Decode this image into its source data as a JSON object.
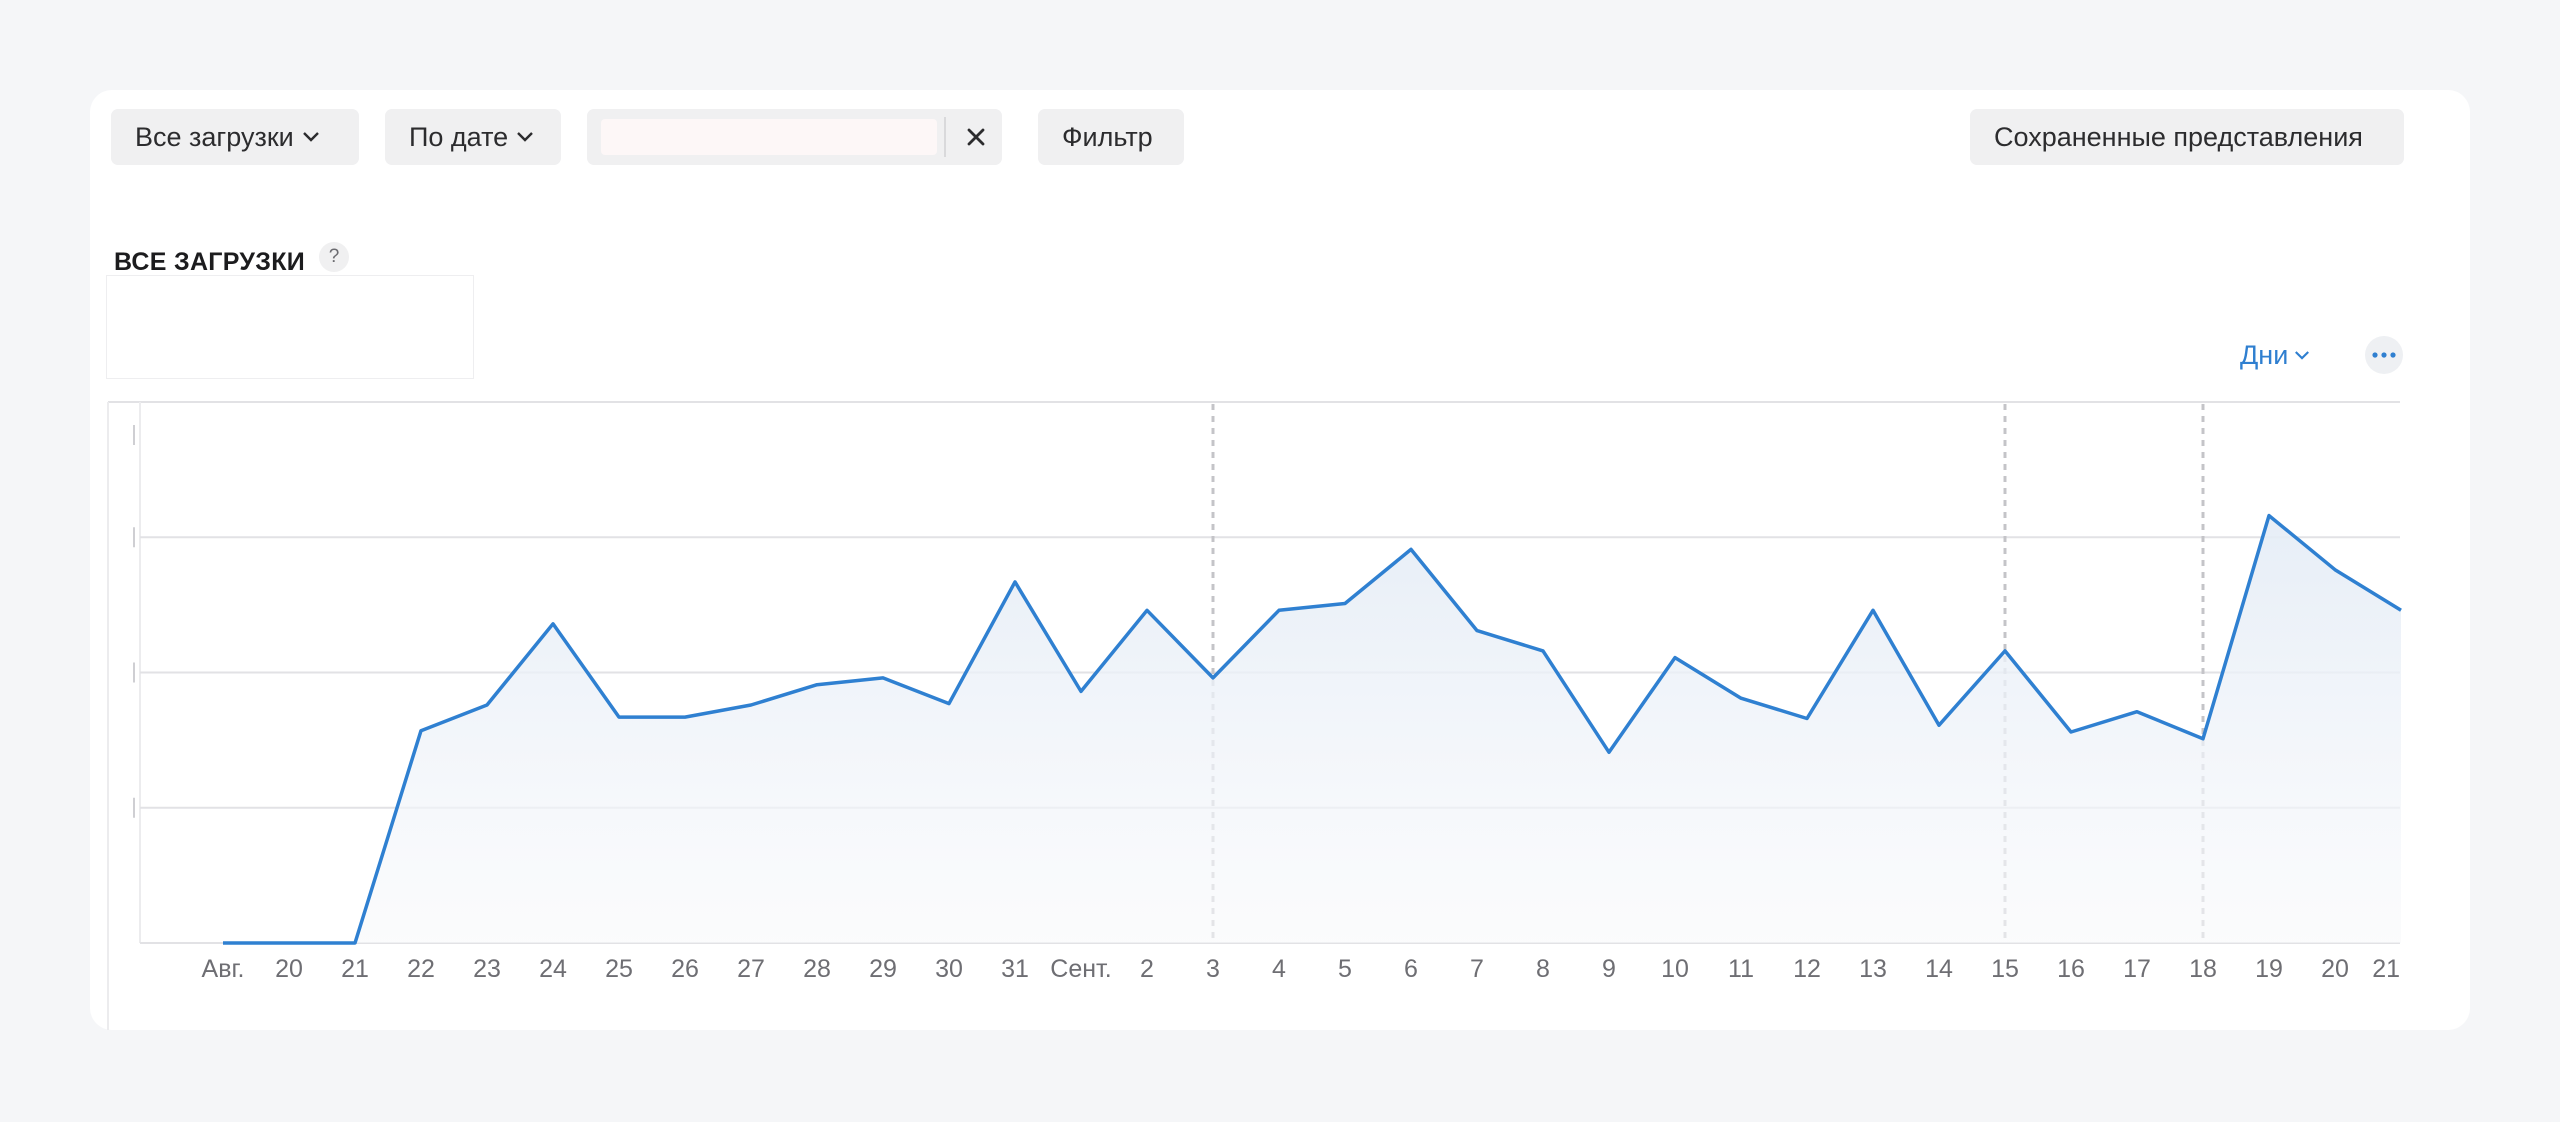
{
  "toolbar": {
    "all_downloads_label": "Все загрузки",
    "by_date_label": "По дате",
    "search_value": "",
    "search_placeholder": "",
    "filter_label": "Фильтр",
    "saved_views_label": "Сохраненные представления"
  },
  "section": {
    "title": "ВСЕ ЗАГРУЗКИ",
    "help": "?"
  },
  "controls": {
    "period_label": "Дни"
  },
  "icons": {
    "dropdown": "chevron-down-icon",
    "clear": "close-icon",
    "help": "help-icon",
    "more": "more-dots-icon"
  },
  "colors": {
    "line": "#2f80d1",
    "accent_text": "#2f7fd0",
    "fill_top": "#e4ecf6",
    "fill_bottom": "#f8f9fb",
    "grid": "#e2e2e5",
    "marker": "#c4c4c8"
  },
  "chart_data": {
    "type": "area",
    "x": [
      "Авг.",
      "20",
      "21",
      "22",
      "23",
      "24",
      "25",
      "26",
      "27",
      "28",
      "29",
      "30",
      "31",
      "Сент.",
      "2",
      "3",
      "4",
      "5",
      "6",
      "7",
      "8",
      "9",
      "10",
      "11",
      "12",
      "13",
      "14",
      "15",
      "16",
      "17",
      "18",
      "19",
      "20",
      "21"
    ],
    "values": [
      0,
      0,
      0,
      1.57,
      1.76,
      2.36,
      1.67,
      1.67,
      1.76,
      1.91,
      1.96,
      1.77,
      2.67,
      1.86,
      2.46,
      1.96,
      2.46,
      2.51,
      2.91,
      2.31,
      2.16,
      1.41,
      2.11,
      1.81,
      1.66,
      2.46,
      1.61,
      2.16,
      1.56,
      1.71,
      1.51,
      3.16,
      2.76,
      2.46
    ],
    "ylim": [
      0,
      4
    ],
    "y_ticks_labeled": false,
    "grid": "horizontal",
    "marker_dates": [
      "3",
      "15",
      "18"
    ],
    "series": [
      {
        "values": [
          0,
          0,
          0,
          1.57,
          1.76,
          2.36,
          1.67,
          1.67,
          1.76,
          1.91,
          1.96,
          1.77,
          2.67,
          1.86,
          2.46,
          1.96,
          2.46,
          2.51,
          2.91,
          2.31,
          2.16,
          1.41,
          2.11,
          1.81,
          1.66,
          2.46,
          1.61,
          2.16,
          1.56,
          1.71,
          1.51,
          3.16,
          2.76,
          2.46
        ]
      }
    ]
  }
}
